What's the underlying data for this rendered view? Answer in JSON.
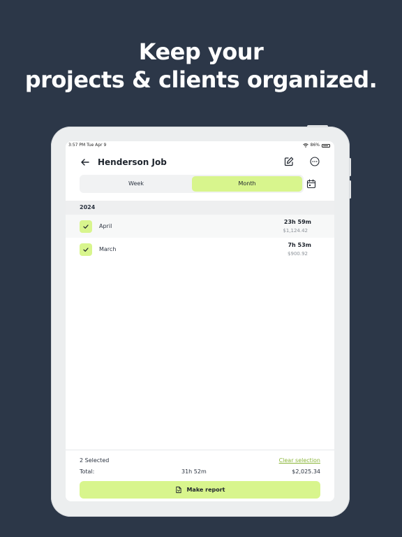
{
  "marketing": {
    "line1": "Keep your",
    "line2": "projects & clients organized."
  },
  "status_bar": {
    "time": "3:57 PM  Tue Apr 9",
    "battery": "86%"
  },
  "header": {
    "title": "Henderson Job",
    "icons": {
      "back": "arrow-left-icon",
      "edit": "edit-icon",
      "more": "more-icon"
    }
  },
  "segments": {
    "week_label": "Week",
    "month_label": "Month",
    "selected": "Month",
    "calendar_icon": "calendar-icon"
  },
  "section": {
    "year": "2024"
  },
  "items": [
    {
      "name": "April",
      "duration": "23h 59m",
      "amount": "$1,124.42",
      "checked": true
    },
    {
      "name": "March",
      "duration": "7h 53m",
      "amount": "$900.92",
      "checked": true
    }
  ],
  "footer": {
    "selected_count": "2 Selected",
    "clear_label": "Clear selection",
    "total_label": "Total:",
    "total_duration": "31h 52m",
    "total_amount": "$2,025.34",
    "make_report_label": "Make report"
  },
  "colors": {
    "background": "#2c3748",
    "accent": "#d8f58d",
    "link": "#8bb63a"
  }
}
